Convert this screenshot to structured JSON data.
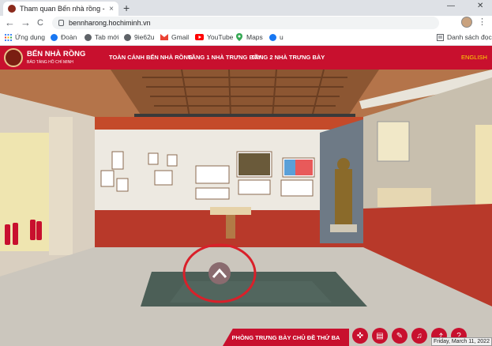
{
  "browser": {
    "tab_title": "Tham quan Bến nhà rồng - B",
    "tab_close": "×",
    "new_tab": "+",
    "url": "bennharong.hochiminh.vn",
    "nav_back": "←",
    "nav_forward": "→",
    "nav_reload": "C",
    "window_min": "—",
    "window_close": "✕",
    "toolbar_icons": [
      "share-icon",
      "star-icon",
      "media-icon",
      "avatar",
      "menu-icon"
    ],
    "menu_glyph": "⋮"
  },
  "bookmarks": {
    "items": [
      {
        "label": "Ứng dụng",
        "icon": "apps-icon",
        "color": "#4285f4"
      },
      {
        "label": "Đoàn",
        "icon": "facebook-icon",
        "color": "#1877f2"
      },
      {
        "label": "Tab mới",
        "icon": "globe-icon",
        "color": "#5f6368"
      },
      {
        "label": "9ie62u",
        "icon": "globe-icon",
        "color": "#5f6368"
      },
      {
        "label": "Gmail",
        "icon": "gmail-icon",
        "color": "#ea4335"
      },
      {
        "label": "YouTube",
        "icon": "youtube-icon",
        "color": "#ff0000"
      },
      {
        "label": "Maps",
        "icon": "maps-icon",
        "color": "#34a853"
      },
      {
        "label": "u",
        "icon": "facebook-icon",
        "color": "#1877f2"
      }
    ],
    "reading_list": "Danh sách đọc"
  },
  "site": {
    "logo_title": "BẾN NHÀ RỒNG",
    "logo_subtitle": "BẢO TÀNG HỒ CHÍ MINH",
    "nav": [
      "TOÀN CẢNH BẾN NHÀ RỒNG",
      "TẦNG 1 NHÀ TRƯNG BÀY",
      "TẦNG 2 NHÀ TRƯNG BÀY"
    ],
    "language": "ENGLISH",
    "accent": "#c8102e"
  },
  "scene": {
    "room_title": "PHÒNG TRƯNG BÀY CHỦ ĐỀ THỨ BA",
    "nav_arrow": "^",
    "tools": [
      {
        "icon": "gamepad-icon",
        "glyph": "✜"
      },
      {
        "icon": "document-icon",
        "glyph": "▤"
      },
      {
        "icon": "pen-icon",
        "glyph": "✎"
      },
      {
        "icon": "music-icon",
        "glyph": "♫"
      },
      {
        "icon": "share-icon",
        "glyph": "⤴"
      },
      {
        "icon": "help-icon",
        "glyph": "?"
      }
    ],
    "date_tooltip": "Friday, March 11, 2022"
  }
}
